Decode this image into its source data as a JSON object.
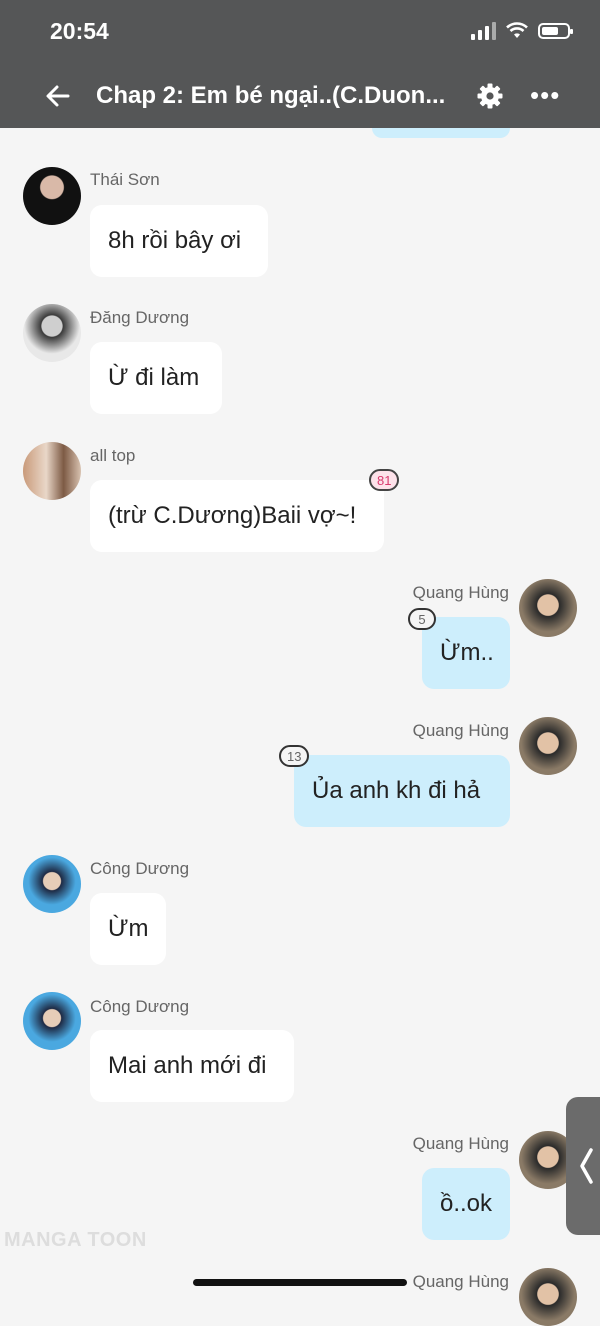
{
  "status_bar": {
    "time": "20:54"
  },
  "header": {
    "title": "Chap 2: Em bé ngại..(C.Duon..."
  },
  "messages": [
    {
      "sender": "Thái Sơn",
      "text": "8h rồi bây ơi",
      "side": "left"
    },
    {
      "sender": "Đăng Dương",
      "text": "Ừ đi làm",
      "side": "left"
    },
    {
      "sender": "all top",
      "text": "(trừ C.Dương)Baii vợ~!",
      "side": "left",
      "badge": "81"
    },
    {
      "sender": "Quang Hùng",
      "text": "Ừm..",
      "side": "right",
      "badge": "5"
    },
    {
      "sender": "Quang Hùng",
      "text": "Ủa anh kh đi hả",
      "side": "right",
      "badge": "13"
    },
    {
      "sender": "Công Dương",
      "text": "Ừm",
      "side": "left"
    },
    {
      "sender": "Công Dương",
      "text": "Mai anh mới đi",
      "side": "left"
    },
    {
      "sender": "Quang Hùng",
      "text": "ồ..ok",
      "side": "right"
    },
    {
      "sender": "Quang Hùng",
      "text": "",
      "side": "right"
    }
  ],
  "watermark": "MANGA TOON",
  "colors": {
    "header_bg": "#555657",
    "right_bubble": "#cdeefc",
    "left_bubble": "#ffffff",
    "page_bg": "#f5f5f5"
  }
}
